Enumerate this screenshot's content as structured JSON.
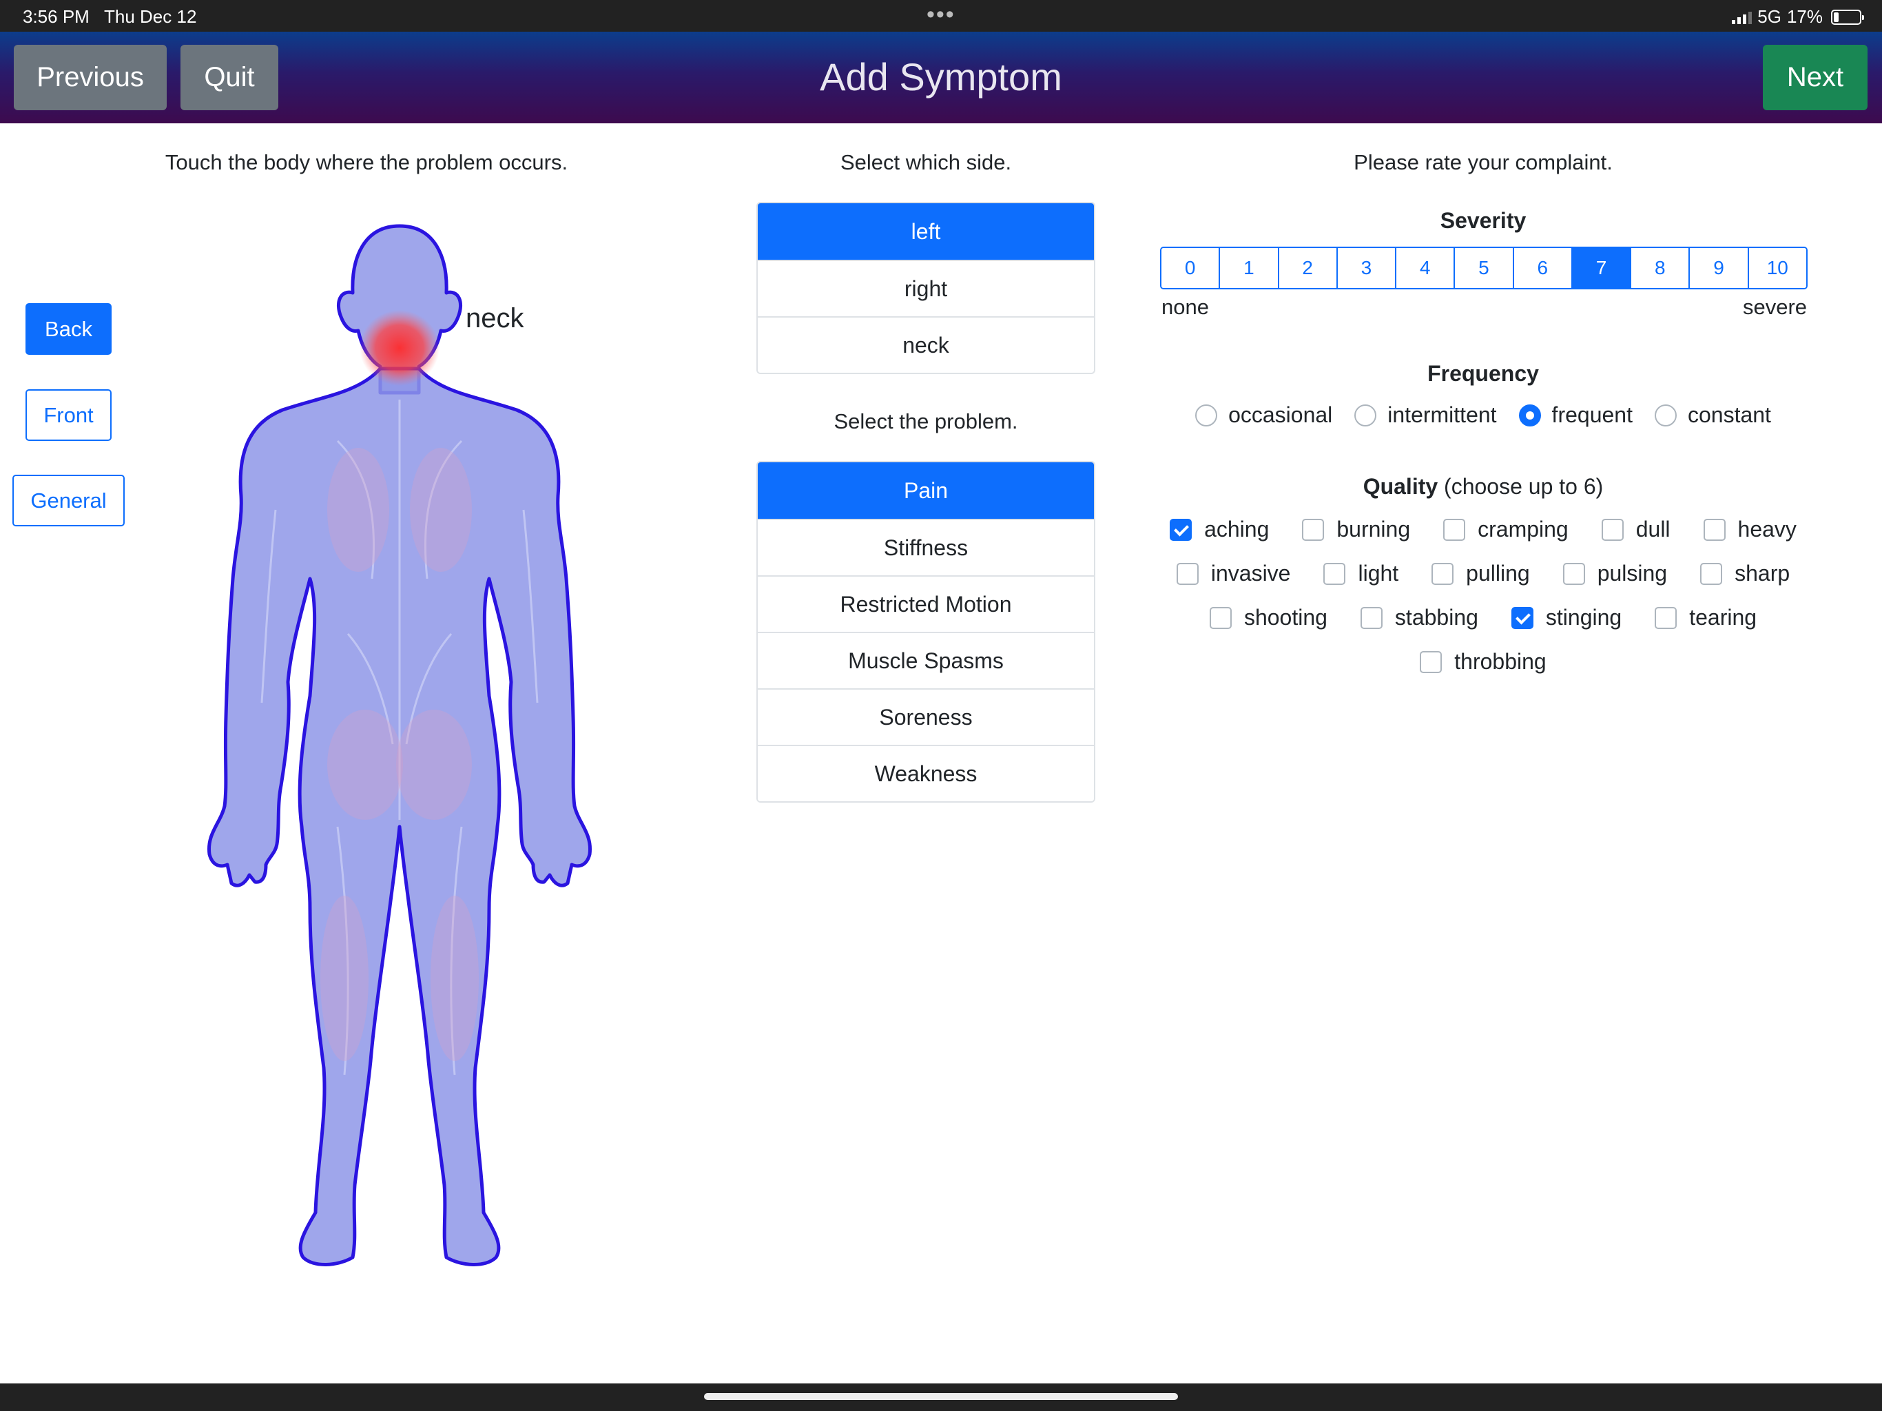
{
  "status_bar": {
    "time": "3:56 PM",
    "date": "Thu Dec 12",
    "network": "5G",
    "battery": "17%"
  },
  "header": {
    "title": "Add Symptom",
    "previous_label": "Previous",
    "quit_label": "Quit",
    "next_label": "Next"
  },
  "body_panel": {
    "instruction": "Touch the body where the problem occurs.",
    "view_buttons": [
      "Back",
      "Front",
      "General"
    ],
    "selected_view": "Back",
    "selected_region_label": "neck"
  },
  "side_panel": {
    "instruction": "Select which side.",
    "options": [
      "left",
      "right",
      "neck"
    ],
    "selected": "left"
  },
  "problem_panel": {
    "instruction": "Select the problem.",
    "options": [
      "Pain",
      "Stiffness",
      "Restricted Motion",
      "Muscle Spasms",
      "Soreness",
      "Weakness"
    ],
    "selected": "Pain"
  },
  "rating": {
    "instruction": "Please rate your complaint.",
    "severity": {
      "label": "Severity",
      "values": [
        "0",
        "1",
        "2",
        "3",
        "4",
        "5",
        "6",
        "7",
        "8",
        "9",
        "10"
      ],
      "selected": "7",
      "min_label": "none",
      "max_label": "severe"
    },
    "frequency": {
      "label": "Frequency",
      "options": [
        "occasional",
        "intermittent",
        "frequent",
        "constant"
      ],
      "selected": "frequent"
    },
    "quality": {
      "label": "Quality",
      "hint": "(choose up to 6)",
      "options": [
        "aching",
        "burning",
        "cramping",
        "dull",
        "heavy",
        "invasive",
        "light",
        "pulling",
        "pulsing",
        "sharp",
        "shooting",
        "stabbing",
        "stinging",
        "tearing",
        "throbbing"
      ],
      "checked": [
        "aching",
        "stinging"
      ]
    }
  },
  "colors": {
    "primary": "#0d6efd",
    "secondary": "#6c757d",
    "success": "#198754",
    "body_fill": "#8e97e8",
    "body_outline": "#2a14e0",
    "highlight": "#ff3b3b"
  }
}
